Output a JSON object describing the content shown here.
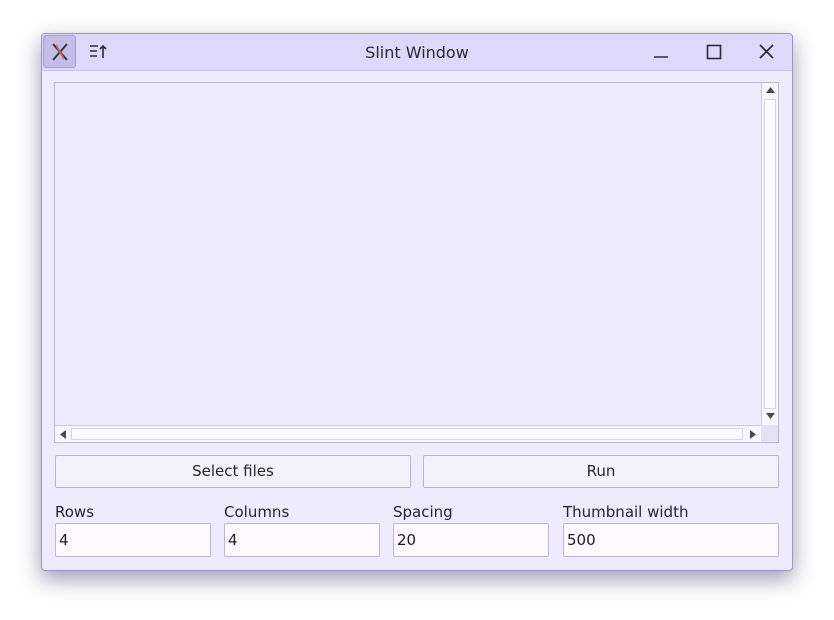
{
  "window": {
    "title": "Slint Window",
    "icons": {
      "app": "slint-app-icon",
      "menu": "sort-menu-icon",
      "minimize": "minimize-icon",
      "maximize": "maximize-icon",
      "close": "close-icon"
    }
  },
  "buttons": {
    "select_files": "Select files",
    "run": "Run"
  },
  "fields": {
    "rows": {
      "label": "Rows",
      "value": "4"
    },
    "columns": {
      "label": "Columns",
      "value": "4"
    },
    "spacing": {
      "label": "Spacing",
      "value": "20"
    },
    "thumbnail_width": {
      "label": "Thumbnail width",
      "value": "500"
    }
  },
  "colors": {
    "window_bg": "#efebfe",
    "titlebar_bg": "#ded8fb",
    "border": "#9b93c9"
  }
}
